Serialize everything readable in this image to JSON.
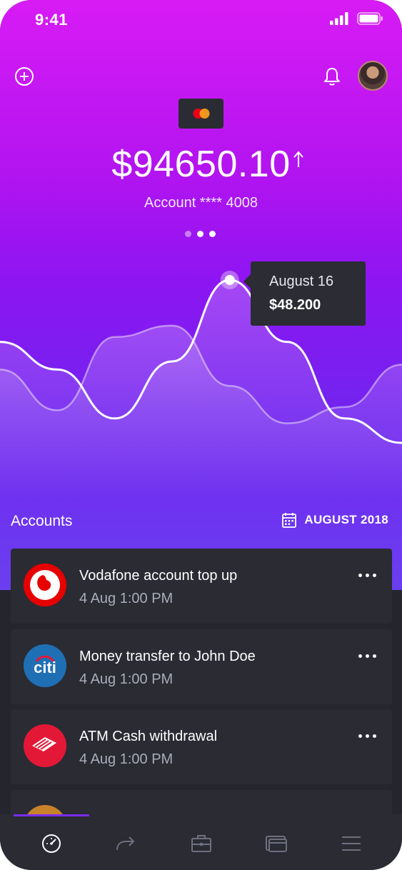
{
  "status_bar": {
    "time": "9:41"
  },
  "header": {
    "add_icon": "plus-circle-icon",
    "bell_icon": "bell-icon",
    "avatar": "user-avatar"
  },
  "card": {
    "brand_icon": "mastercard-icon",
    "balance": "$94650.10",
    "trend_icon": "arrow-up-icon",
    "account": "Account **** 4008",
    "pager": {
      "pages": 3,
      "active": 2
    }
  },
  "chart_data": {
    "type": "line",
    "series": [
      {
        "values": [
          0.62,
          0.45,
          0.15,
          0.5,
          1.0,
          0.62,
          0.15,
          0.0
        ]
      },
      {
        "values": [
          0.45,
          0.2,
          0.65,
          0.72,
          0.35,
          0.12,
          0.22,
          0.48
        ]
      }
    ],
    "tooltip": {
      "date": "August 16",
      "value": "$48.200"
    },
    "colors": {
      "line": "#ffffff",
      "fill": "#ffffff"
    }
  },
  "accounts": {
    "title": "Accounts",
    "calendar_icon": "calendar-icon",
    "month": "AUGUST 2018"
  },
  "transactions": [
    {
      "title": "Vodafone account top up",
      "date": "4 Aug 1:00 PM",
      "logo": "vodafone-logo",
      "color": "#e60000"
    },
    {
      "title": "Money transfer to John Doe",
      "date": "4 Aug 1:00 PM",
      "logo": "citi-logo",
      "logo_text": "citi",
      "color": "#1f6fb5"
    },
    {
      "title": "ATM Cash withdrawal",
      "date": "4 Aug 1:00 PM",
      "logo": "bank-of-america-logo",
      "color": "#e31837"
    }
  ],
  "tabbar": {
    "tabs": [
      "dashboard-icon",
      "transfer-icon",
      "briefcase-icon",
      "wallet-icon",
      "menu-icon"
    ],
    "active": 0
  }
}
